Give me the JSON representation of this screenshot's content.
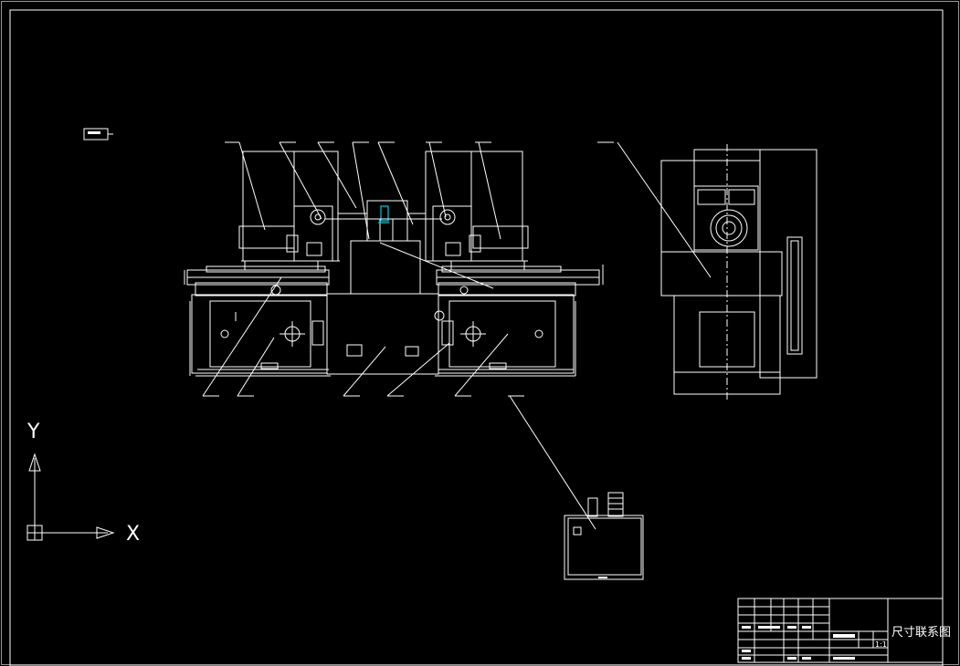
{
  "drawing": {
    "title_block": {
      "drawing_name": "尺寸联系图",
      "scale": "1:1"
    }
  },
  "ucs": {
    "x_label": "X",
    "y_label": "Y"
  },
  "icons": {
    "ucs": "ucs-axis-icon"
  },
  "colors": {
    "background": "#000000",
    "linework": "#ffffff",
    "accent": "#00c8d8"
  }
}
